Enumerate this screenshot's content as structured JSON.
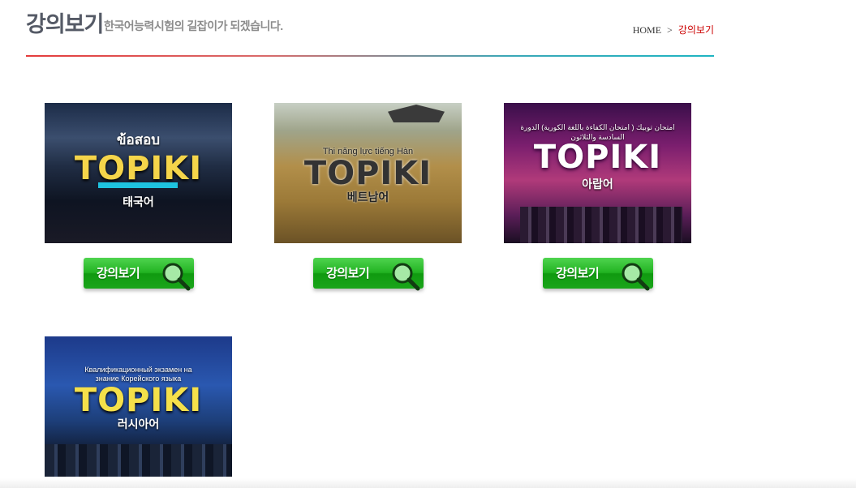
{
  "header": {
    "title": "강의보기",
    "subtitle": "한국어능력시험의 길잡이가 되겠습니다.",
    "breadcrumb": {
      "home": "HOME",
      "separator": ">",
      "current": "강의보기"
    }
  },
  "courses": [
    {
      "top_text": "ข้อสอบ",
      "logo": "TOPIKⅠ",
      "name": "태국어",
      "button_label": "강의보기"
    },
    {
      "top_text": "Thi năng lực tiếng Hàn",
      "logo": "TOPIKⅠ",
      "name": "베트남어",
      "button_label": "강의보기"
    },
    {
      "top_text": "امتحان توبيك ( امتحان الكفاءة باللغة الكورية) الدورة السادسة والثلاثون",
      "logo": "TOPIKⅠ",
      "name": "아랍어",
      "button_label": "강의보기"
    },
    {
      "top_text": "Квалификационный экзамен на знание Корейского языка",
      "logo": "TOPIKⅠ",
      "name": "러시아어"
    }
  ],
  "colors": {
    "accent_red": "#cc0000",
    "button_green": "#22b322",
    "rule_left": "#e43c3c",
    "rule_right": "#1fb5c2"
  },
  "icons": {
    "view_button": "magnifier-icon"
  }
}
